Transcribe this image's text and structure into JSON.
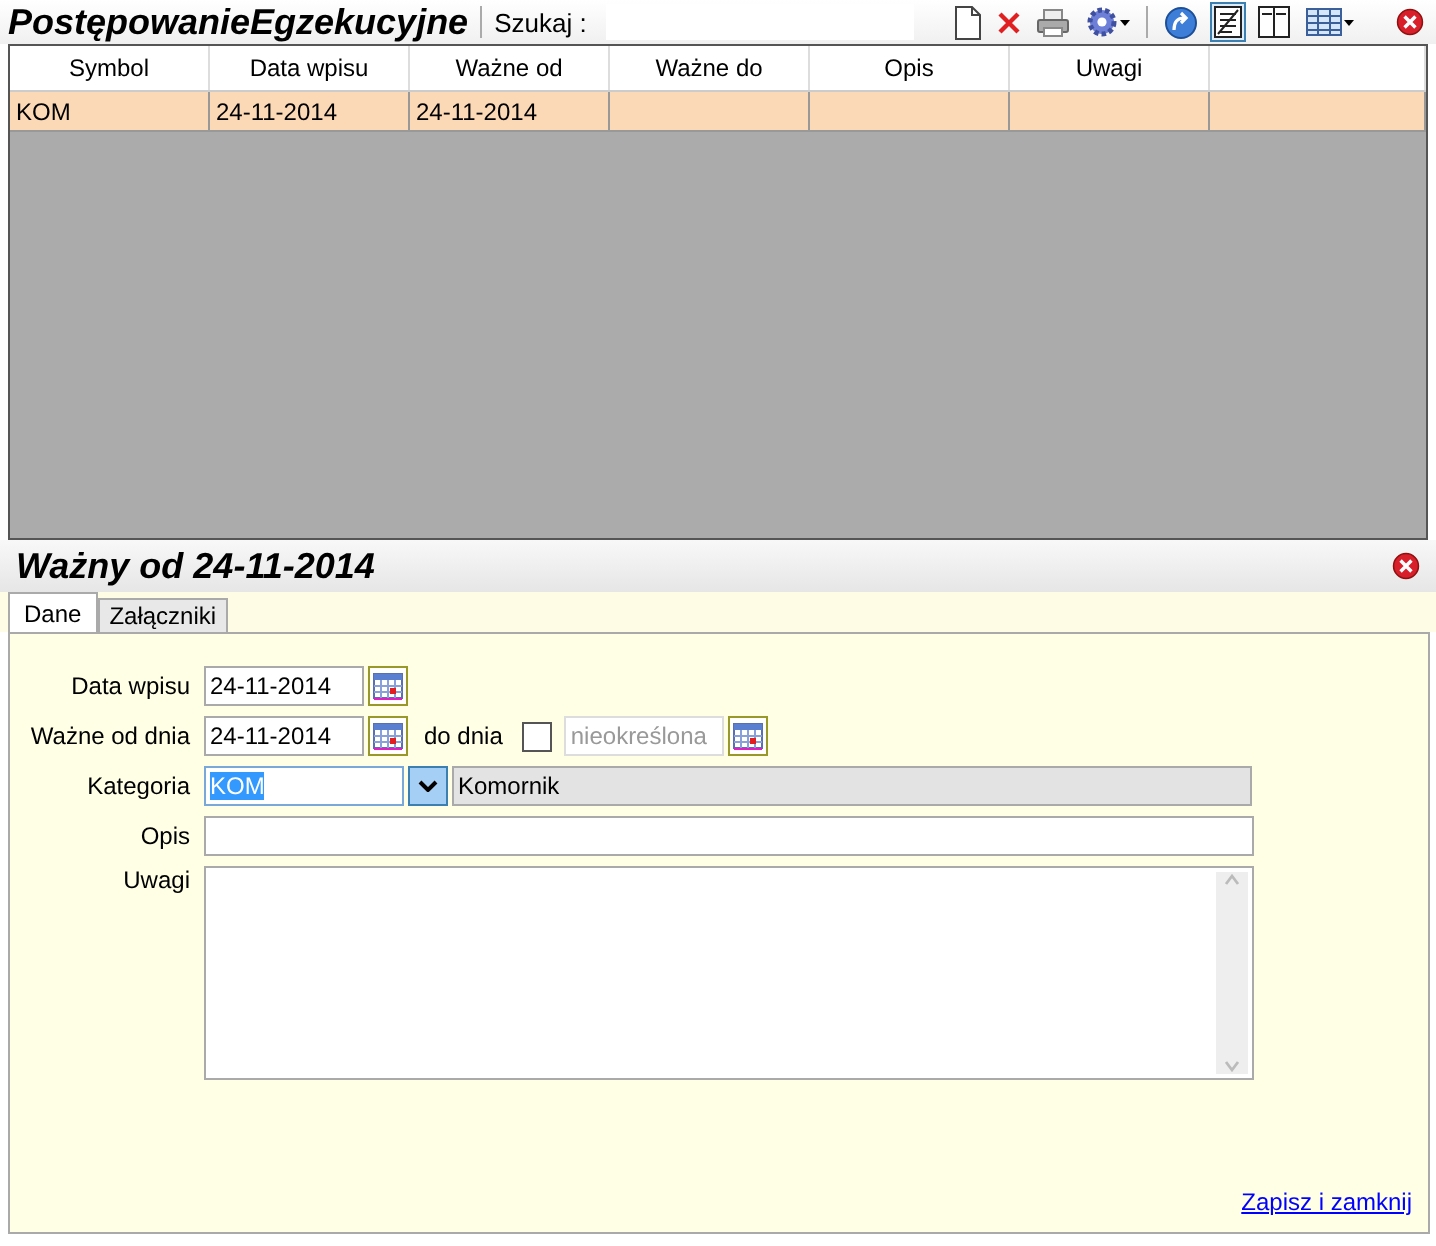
{
  "window": {
    "title": "PostępowanieEgzekucyjne"
  },
  "search": {
    "label": "Szukaj  :"
  },
  "toolbar": [
    {
      "kind": "new",
      "selected": false
    },
    {
      "kind": "delete",
      "selected": false
    },
    {
      "kind": "print",
      "selected": false
    },
    {
      "kind": "settings",
      "selected": false
    },
    {
      "kind": "refresh",
      "selected": false
    },
    {
      "kind": "details",
      "selected": true
    },
    {
      "kind": "split",
      "selected": false
    },
    {
      "kind": "grid",
      "selected": false
    }
  ],
  "table": {
    "columns": [
      "Symbol",
      "Data wpisu",
      "Ważne od",
      "Ważne do",
      "Opis",
      "Uwagi"
    ],
    "rows": [
      {
        "selected": true,
        "cells": [
          "KOM",
          "24-11-2014",
          "24-11-2014",
          "",
          "",
          ""
        ]
      }
    ]
  },
  "detail": {
    "title": "Ważny od 24-11-2014",
    "tabs": [
      {
        "label": "Dane",
        "selected": true
      },
      {
        "label": "Załączniki",
        "selected": false
      }
    ],
    "data_wpisu": {
      "label": "Data wpisu",
      "value": "24-11-2014"
    },
    "wazne_od": {
      "label": "Ważne od dnia",
      "value": "24-11-2014"
    },
    "do_dnia": {
      "label": "do dnia",
      "checked": false,
      "placeholder": "nieokreślona"
    },
    "kategoria": {
      "label": "Kategoria",
      "value": "KOM",
      "description": "Komornik"
    },
    "opis": {
      "label": "Opis"
    },
    "uwagi": {
      "label": "Uwagi"
    },
    "save_link": "Zapisz i zamknij"
  }
}
